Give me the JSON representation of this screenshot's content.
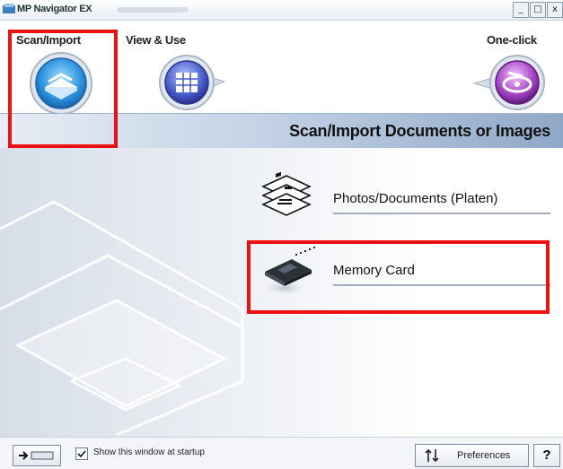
{
  "window": {
    "title": "MP Navigator EX",
    "controls": [
      "_",
      "□",
      "x"
    ]
  },
  "nav": {
    "tabs": [
      {
        "label": "Scan/Import",
        "icon": "scanner-icon"
      },
      {
        "label": "View & Use",
        "icon": "grid-document-icon"
      },
      {
        "label": "One-click",
        "icon": "one-click-disc-icon"
      }
    ]
  },
  "header": {
    "title": "Scan/Import Documents or Images"
  },
  "options": [
    {
      "label": "Photos/Documents (Platen)",
      "icon": "document-stack-icon"
    },
    {
      "label": "Memory Card",
      "icon": "memory-card-icon"
    }
  ],
  "footer": {
    "startup_checkbox_label": "Show this window at startup",
    "startup_checked": true,
    "preferences_label": "Preferences",
    "help_label": "?"
  },
  "colors": {
    "highlight": "#ee1111",
    "accent_blue": "#3a8fd6",
    "one_click_purple": "#9a3bb0"
  }
}
